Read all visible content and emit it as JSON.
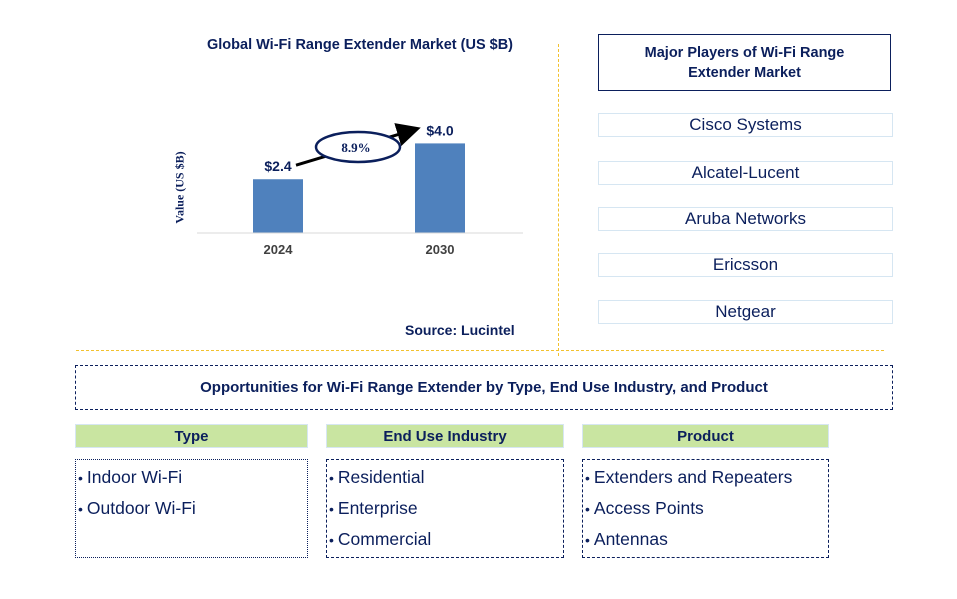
{
  "chart_data": {
    "type": "bar",
    "title": "Global Wi-Fi Range Extender Market (US $B)",
    "xlabel": "",
    "ylabel": "Value (US $B)",
    "categories": [
      "2024",
      "2030"
    ],
    "values": [
      2.4,
      4.0
    ],
    "data_labels": [
      "$2.4",
      "$4.0"
    ],
    "ylim": [
      0,
      5
    ],
    "grid": false,
    "annotation": {
      "text": "8.9%",
      "type": "CAGR arrow from 2024 to 2030"
    },
    "bar_color": "#4f81bd",
    "source": "Source: Lucintel"
  },
  "players": {
    "title": "Major Players of Wi-Fi Range Extender Market",
    "items": [
      "Cisco Systems",
      "Alcatel-Lucent",
      "Aruba Networks",
      "Ericsson",
      "Netgear"
    ]
  },
  "opportunities": {
    "title": "Opportunities for Wi-Fi Range Extender by Type, End Use Industry, and Product",
    "categories": [
      {
        "heading": "Type",
        "items": [
          "Indoor Wi-Fi",
          "Outdoor Wi-Fi"
        ]
      },
      {
        "heading": "End Use Industry",
        "items": [
          "Residential",
          "Enterprise",
          "Commercial"
        ]
      },
      {
        "heading": "Product",
        "items": [
          "Extenders and Repeaters",
          "Access Points",
          "Antennas"
        ]
      }
    ],
    "bullet": "•"
  },
  "colors": {
    "text": "#0b1f5c",
    "bar": "#4f81bd",
    "header_fill": "#c9e5a1",
    "divider": "#f2c12e"
  }
}
